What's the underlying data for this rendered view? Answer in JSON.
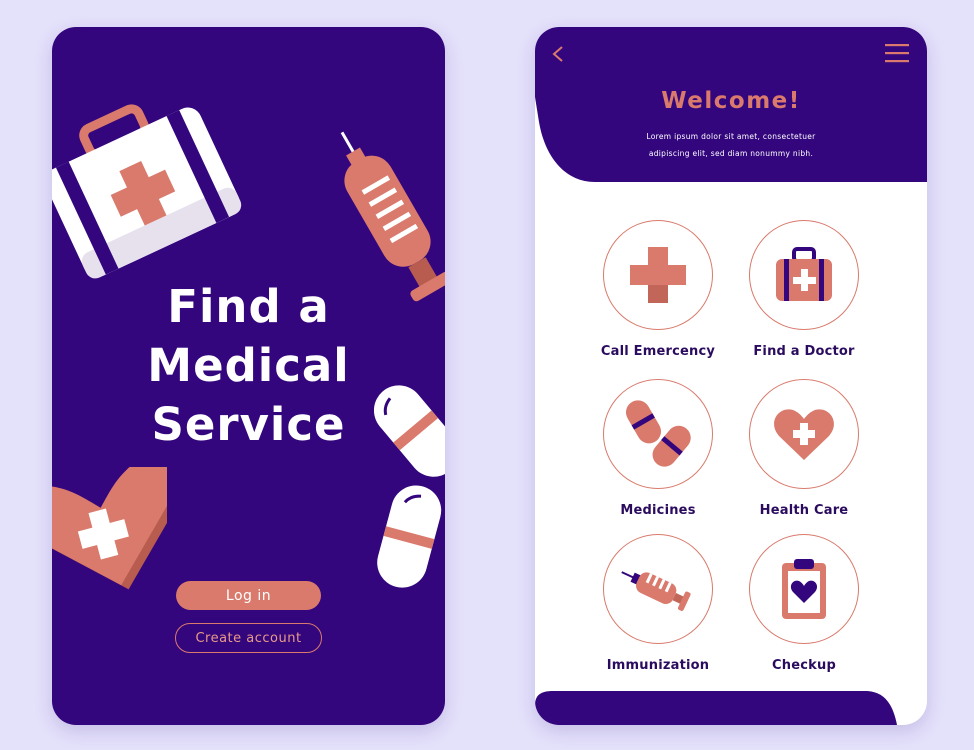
{
  "colors": {
    "background": "#e4e1fb",
    "primary_purple": "#33067d",
    "accent_coral": "#d97a6c",
    "white": "#ffffff",
    "dark_text": "#2a0b5e"
  },
  "left_screen": {
    "headline": [
      "Find a",
      "Medical",
      "Service"
    ],
    "login_label": "Log in",
    "create_account_label": "Create account",
    "decorations": [
      "first-aid-kit-icon",
      "syringe-icon",
      "pill-icon",
      "pill-icon",
      "heart-plus-icon"
    ]
  },
  "right_screen": {
    "back_icon": "chevron-left-icon",
    "menu_icon": "hamburger-menu-icon",
    "title": "Welcome!",
    "subtitle_lines": [
      "Lorem ipsum dolor sit amet, consectetuer",
      "adipiscing elit, sed diam nonummy nibh."
    ],
    "services": [
      {
        "label": "Call Emercency",
        "icon": "medical-cross-icon"
      },
      {
        "label": "Find a Doctor",
        "icon": "medical-bag-icon"
      },
      {
        "label": "Medicines",
        "icon": "pills-icon"
      },
      {
        "label": "Health Care",
        "icon": "heart-plus-icon"
      },
      {
        "label": "Immunization",
        "icon": "syringe-icon"
      },
      {
        "label": "Checkup",
        "icon": "clipboard-heart-icon"
      }
    ]
  }
}
